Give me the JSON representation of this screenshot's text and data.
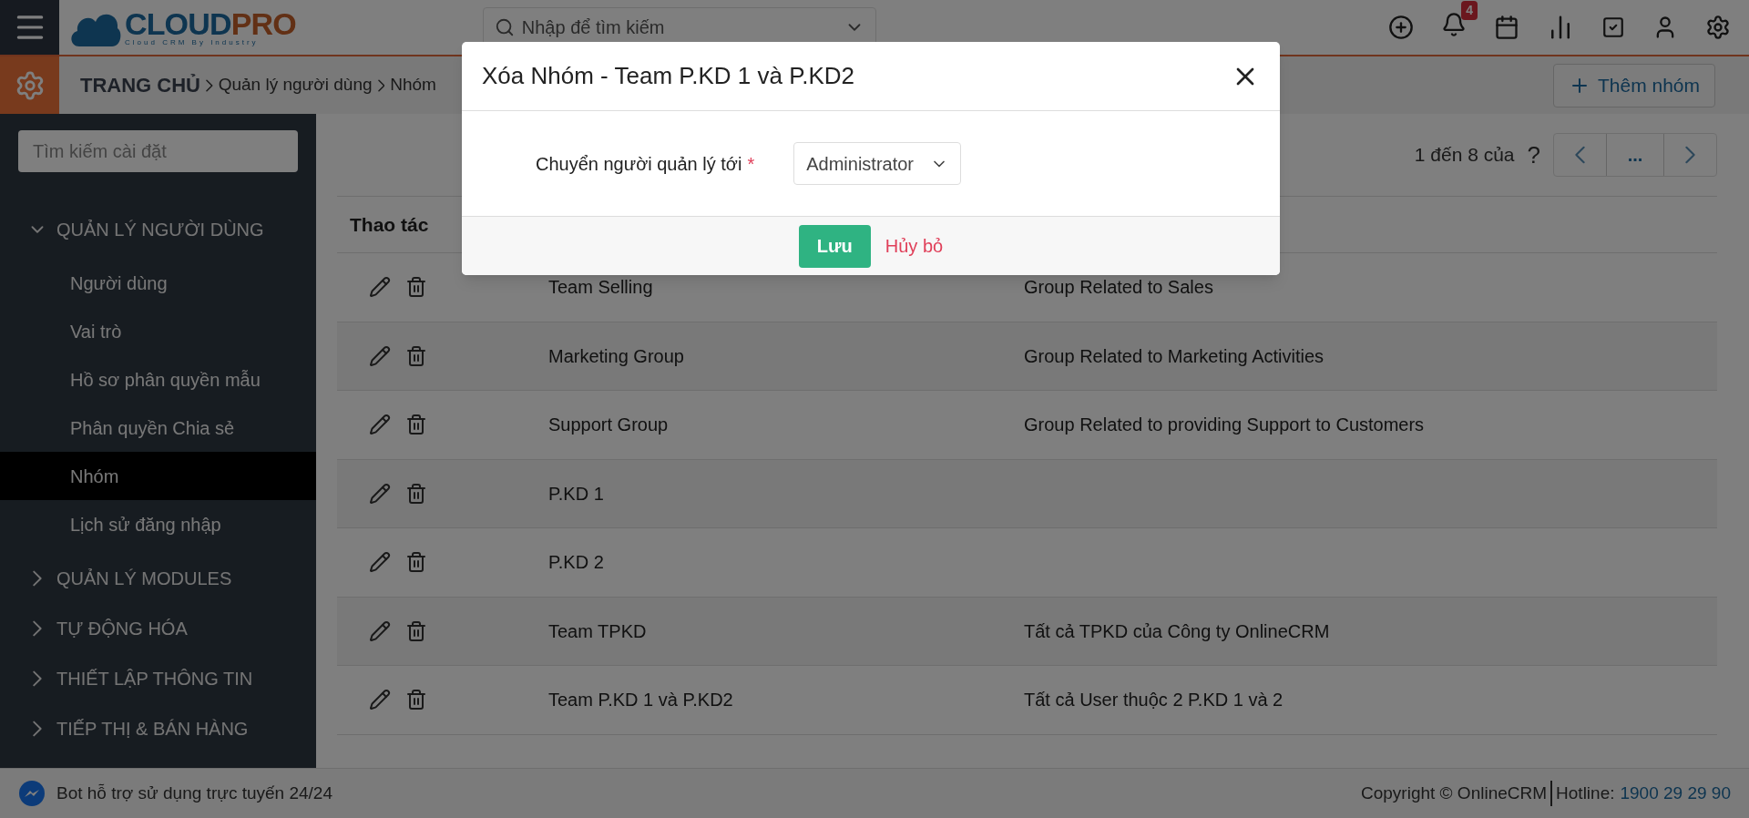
{
  "header": {
    "logo": {
      "part_1": "CLOUD",
      "part_2": "PRO",
      "tagline": "Cloud CRM By Industry"
    },
    "search": {
      "placeholder": "Nhập để tìm kiếm"
    },
    "notification_count": "4"
  },
  "breadcrumb": {
    "items": [
      "TRANG CHỦ",
      "Quản lý người dùng",
      "Nhóm"
    ],
    "add_button": "Thêm nhóm"
  },
  "sidebar": {
    "search": {
      "placeholder": "Tìm kiếm cài đặt"
    },
    "sections": [
      {
        "label": "QUẢN LÝ NGƯỜI DÙNG",
        "expanded": true,
        "children": [
          {
            "label": "Người dùng",
            "selected": false
          },
          {
            "label": "Vai trò",
            "selected": false
          },
          {
            "label": "Hồ sơ phân quyền mẫu",
            "selected": false
          },
          {
            "label": "Phân quyền Chia sẻ",
            "selected": false
          },
          {
            "label": "Nhóm",
            "selected": true
          },
          {
            "label": "Lịch sử đăng nhập",
            "selected": false
          }
        ]
      },
      {
        "label": "QUẢN LÝ MODULES",
        "expanded": false
      },
      {
        "label": "TỰ ĐỘNG HÓA",
        "expanded": false
      },
      {
        "label": "THIẾT LẬP THÔNG TIN",
        "expanded": false
      },
      {
        "label": "TIẾP THỊ & BÁN HÀNG",
        "expanded": false
      }
    ]
  },
  "pagination": {
    "range": "1 đến 8 của",
    "total": "?",
    "more": "..."
  },
  "table": {
    "columns": [
      "Thao tác"
    ],
    "rows": [
      {
        "name": "Team Selling",
        "description": "Group Related to Sales"
      },
      {
        "name": "Marketing Group",
        "description": "Group Related to Marketing Activities"
      },
      {
        "name": "Support Group",
        "description": "Group Related to providing Support to Customers"
      },
      {
        "name": "P.KD 1"
      },
      {
        "name": "P.KD 2"
      },
      {
        "name": "Team TPKD",
        "description": "Tất cả TPKD của Công ty OnlineCRM"
      },
      {
        "name": "Team P.KD 1 và P.KD2",
        "description": "Tất cả User thuộc 2 P.KD 1 và 2"
      }
    ]
  },
  "modal": {
    "title": "Xóa Nhóm - Team P.KD 1 và P.KD2",
    "field_label": "Chuyển người quản lý tới",
    "required_mark": "*",
    "select_value": "Administrator",
    "save_button": "Lưu",
    "cancel_link": "Hủy bỏ"
  },
  "footer": {
    "bot_text": "Bot hỗ trợ sử dụng trực tuyến 24/24",
    "copyright": "Copyright © OnlineCRM",
    "hotline_label": "Hotline:",
    "hotline_number": "1900 29 29 90"
  }
}
